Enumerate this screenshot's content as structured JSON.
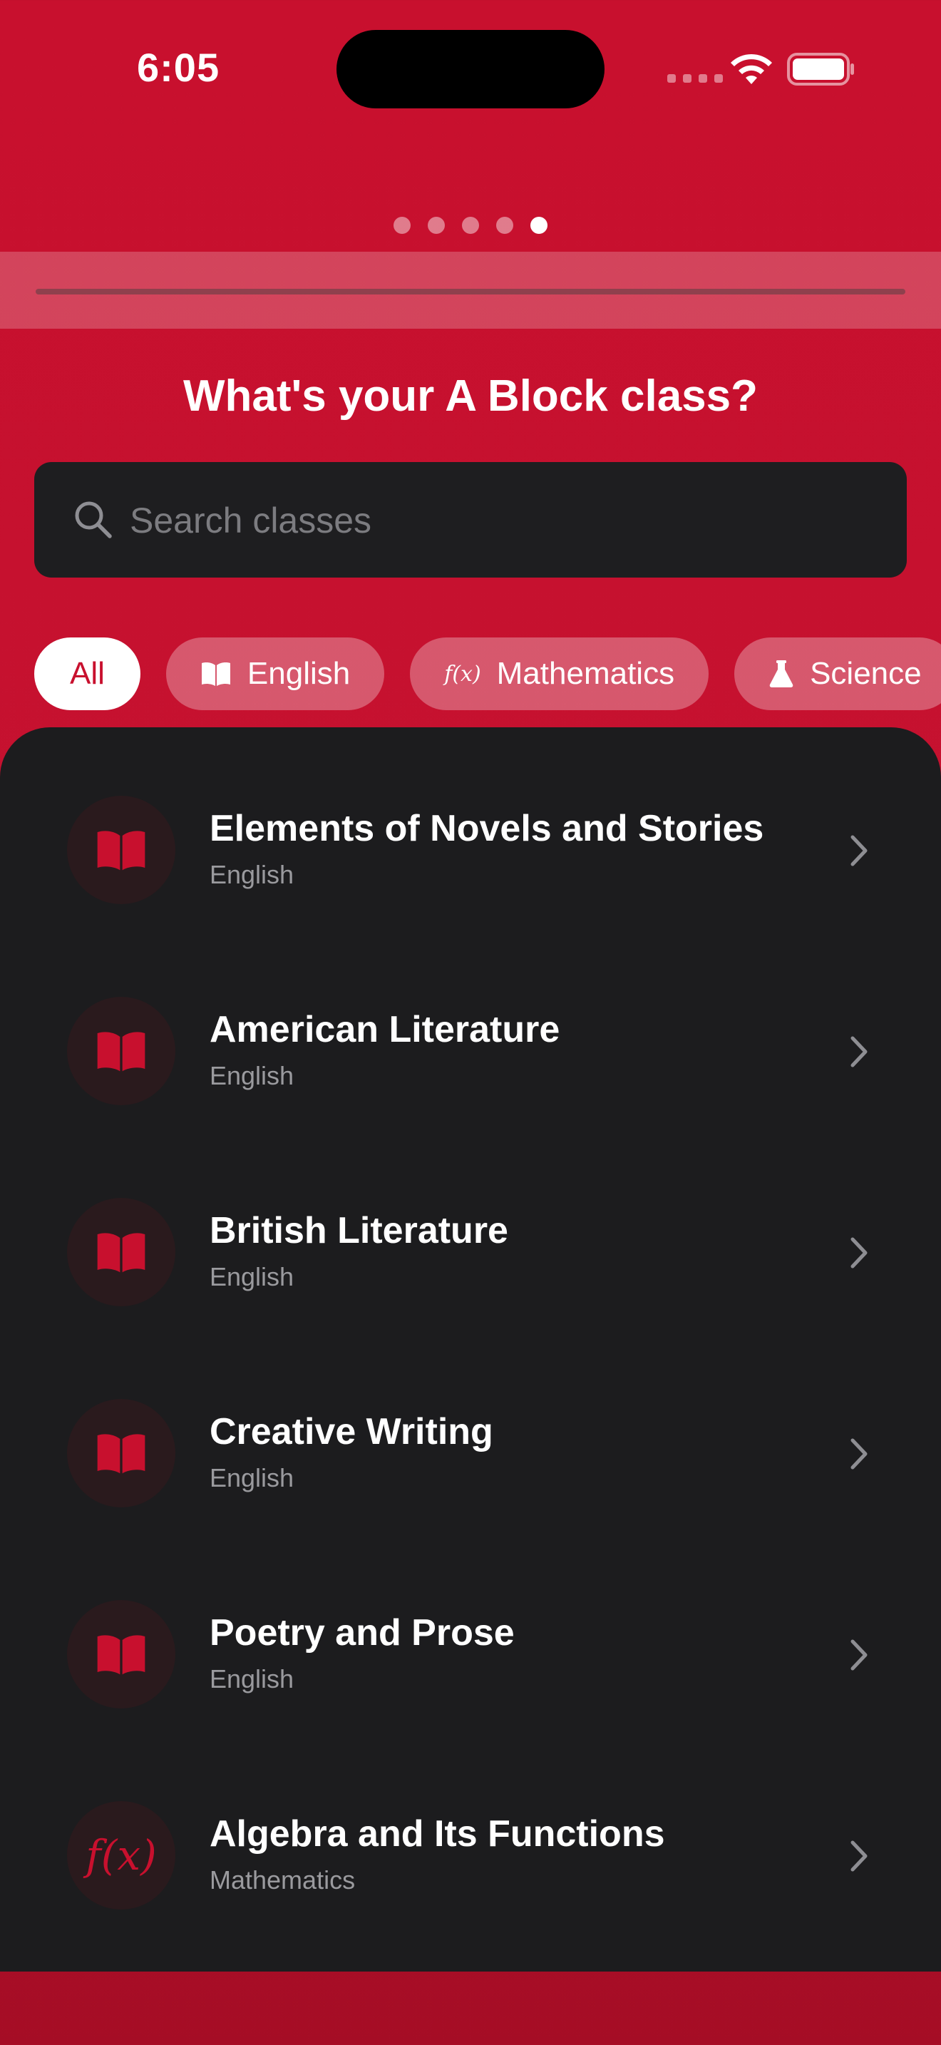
{
  "status_bar": {
    "time": "6:05"
  },
  "pager": {
    "total": 5,
    "active_index": 4
  },
  "page": {
    "title": "What's your A Block class?"
  },
  "search": {
    "placeholder": "Search classes",
    "value": ""
  },
  "filters": [
    {
      "label": "All",
      "icon": "",
      "selected": true
    },
    {
      "label": "English",
      "icon": "book-icon",
      "selected": false
    },
    {
      "label": "Mathematics",
      "icon": "function-icon",
      "icon_text": "f(x)",
      "selected": false
    },
    {
      "label": "Science",
      "icon": "flask-icon",
      "selected": false
    }
  ],
  "classes": [
    {
      "title": "Elements of Novels and Stories",
      "subject": "English",
      "icon": "book-icon"
    },
    {
      "title": "American Literature",
      "subject": "English",
      "icon": "book-icon"
    },
    {
      "title": "British Literature",
      "subject": "English",
      "icon": "book-icon"
    },
    {
      "title": "Creative Writing",
      "subject": "English",
      "icon": "book-icon"
    },
    {
      "title": "Poetry and Prose",
      "subject": "English",
      "icon": "book-icon"
    },
    {
      "title": "Algebra and Its Functions",
      "subject": "Mathematics",
      "icon": "function-icon",
      "icon_text": "f(x)"
    }
  ],
  "colors": {
    "accent": "#c8102e",
    "panel": "#1c1c1e",
    "search_bg": "#1e1e20",
    "subtitle": "#9a9a9e"
  }
}
